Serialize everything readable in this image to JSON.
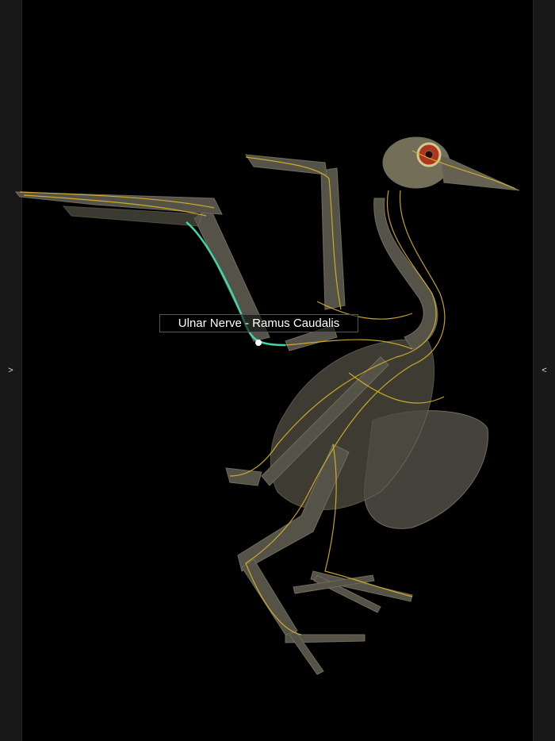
{
  "left_panel": {
    "toggle": ">"
  },
  "right_panel": {
    "toggle": "<"
  },
  "viewer": {
    "selected_label": "Ulnar Nerve - Ramus Caudalis",
    "colors": {
      "bone": "#6b6758",
      "nerve": "#d9b52a",
      "highlight": "#3fd6a8",
      "eye": "#c0391f"
    }
  }
}
